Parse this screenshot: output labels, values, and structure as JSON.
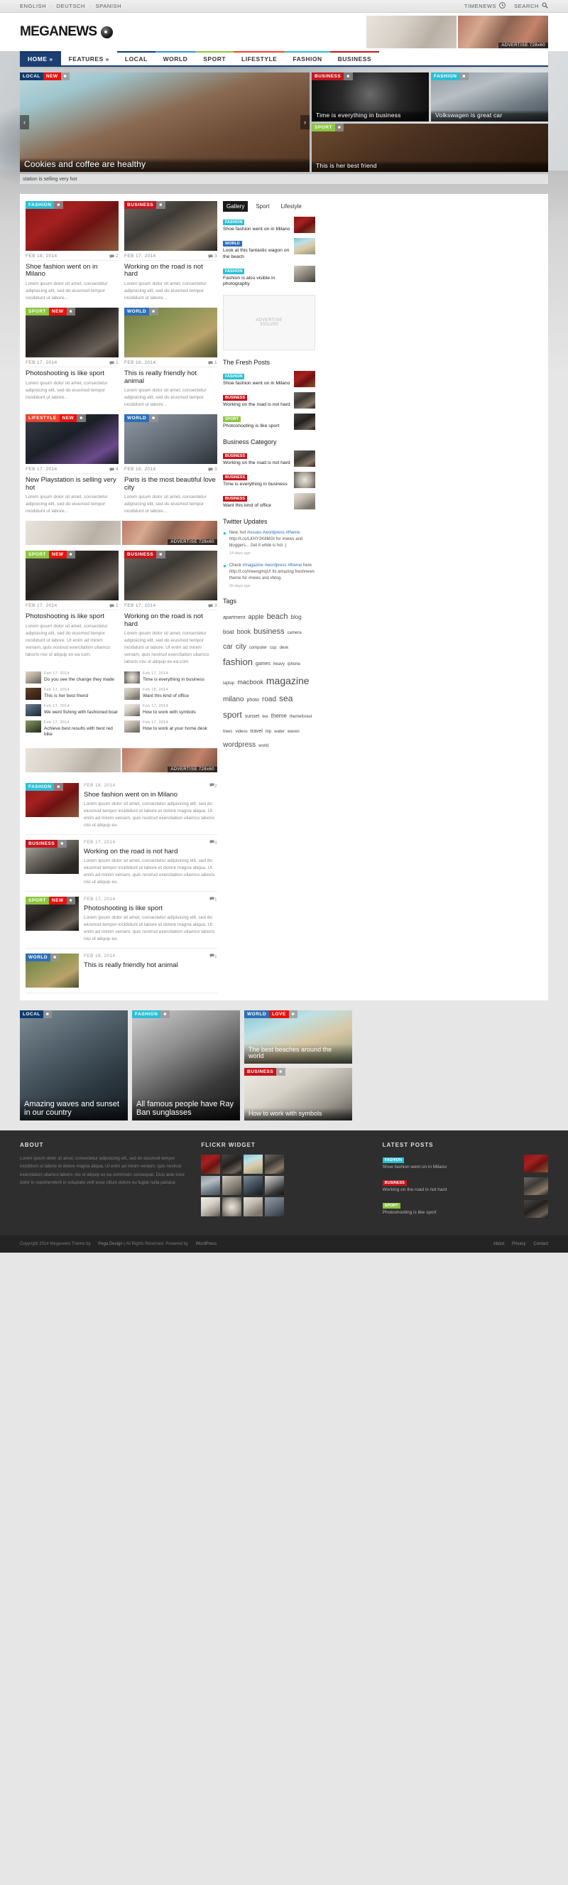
{
  "topbar": {
    "languages": [
      "ENGLISH",
      "DEUTSCH",
      "SPANISH"
    ],
    "separator": "·",
    "timenews_label": "TIMENEWS",
    "search_label": "SEARCH",
    "clock_icon": "clock-icon",
    "search_icon": "search-icon"
  },
  "header": {
    "logo_mega": "MEGA",
    "logo_news": "NEWS",
    "ad_label": "ADVERTISE  728x60"
  },
  "nav": {
    "items": [
      {
        "label": "HOME »",
        "active": true,
        "cls": ""
      },
      {
        "label": "FEATURES »",
        "active": false,
        "cls": ""
      },
      {
        "label": "LOCAL",
        "active": false,
        "cls": "c-local"
      },
      {
        "label": "WORLD",
        "active": false,
        "cls": "c-world"
      },
      {
        "label": "SPORT",
        "active": false,
        "cls": "c-sport"
      },
      {
        "label": "LIFESTYLE",
        "active": false,
        "cls": "c-life"
      },
      {
        "label": "FASHION",
        "active": false,
        "cls": "c-fash"
      },
      {
        "label": "BUSINESS",
        "active": false,
        "cls": "c-bus"
      }
    ]
  },
  "slider": {
    "prev_icon": "chevron-left-icon",
    "next_icon": "chevron-right-icon",
    "main": {
      "badges": [
        {
          "text": "LOCAL",
          "cls": "b-local"
        },
        {
          "text": "NEW",
          "cls": "b-new"
        }
      ],
      "icon": "camera-icon",
      "caption": "Cookies and coffee are healthy"
    },
    "cells": [
      {
        "badges": [
          {
            "text": "BUSINESS",
            "cls": "b-bus"
          }
        ],
        "icon": "camera-icon",
        "caption": "Time is everything in business",
        "photo": "ph-clock"
      },
      {
        "badges": [
          {
            "text": "FASHION",
            "cls": "b-fash"
          }
        ],
        "icon": "camera-icon",
        "caption": "Volkswagen is great car",
        "photo": "ph-van"
      },
      {
        "badges": [
          {
            "text": "SPORT",
            "cls": "b-sport"
          }
        ],
        "icon": "camera-icon",
        "caption": "This is her best friend",
        "photo": "ph-dog"
      }
    ]
  },
  "ticker": {
    "text": "station is selling very hot"
  },
  "posts_grid": [
    [
      {
        "badges": [
          {
            "text": "FASHION",
            "cls": "b-fash"
          }
        ],
        "icon": "camera-icon",
        "photo": "ph-shoe",
        "date": "FEB 18, 2014",
        "comments": "2",
        "title": "Shoe fashion went on in Milano",
        "excerpt": "Lorem ipsum dolor sit amet, consectetur adipisicing elit, sed do eiusmod tempor incididunt ut labore..."
      },
      {
        "badges": [
          {
            "text": "BUSINESS",
            "cls": "b-bus"
          }
        ],
        "icon": "camera-icon",
        "photo": "ph-laptop",
        "date": "FEB 17, 2014",
        "comments": "3",
        "title": "Working on the road is not hard",
        "excerpt": "Lorem ipsum dolor sit amet, consectetur adipisicing elit, sed do eiusmod tempor incididunt ut labore..."
      }
    ],
    [
      {
        "badges": [
          {
            "text": "SPORT",
            "cls": "b-sport"
          },
          {
            "text": "NEW",
            "cls": "b-new"
          }
        ],
        "icon": "camera-icon",
        "photo": "ph-camera",
        "date": "FEB 17, 2014",
        "comments": "1",
        "title": "Photoshooting is like sport",
        "excerpt": "Lorem ipsum dolor sit amet, consectetur adipisicing elit, sed do eiusmod tempor incididunt ut labore..."
      },
      {
        "badges": [
          {
            "text": "WORLD",
            "cls": "b-world"
          }
        ],
        "icon": "camera-icon",
        "photo": "ph-leopard",
        "date": "FEB 16, 2014",
        "comments": "1",
        "title": "This is really friendly hot animal",
        "excerpt": "Lorem ipsum dolor sit amet, consectetur adipisicing elit, sed do eiusmod tempor incididunt ut labore..."
      }
    ],
    [
      {
        "badges": [
          {
            "text": "LIFESTYLE",
            "cls": "b-life"
          },
          {
            "text": "NEW",
            "cls": "b-new"
          }
        ],
        "icon": "camera-icon",
        "photo": "ph-play",
        "date": "FEB 17, 2014",
        "comments": "4",
        "title": "New Playstation is selling very hot",
        "excerpt": "Lorem ipsum dolor sit amet, consectetur adipisicing elit, sed do eiusmod tempor incididunt ut labore..."
      },
      {
        "badges": [
          {
            "text": "WORLD",
            "cls": "b-world"
          }
        ],
        "icon": "camera-icon",
        "photo": "ph-paris",
        "date": "FEB 16, 2014",
        "comments": "3",
        "title": "Paris is the most beautiful love city",
        "excerpt": "Lorem ipsum dolor sit amet, consectetur adipisicing elit, sed do eiusmod tempor incididunt ut labore..."
      }
    ]
  ],
  "inline_ad_label": "ADVERTISE  728x60",
  "posts_grid2": [
    {
      "badges": [
        {
          "text": "SPORT",
          "cls": "b-sport"
        },
        {
          "text": "NEW",
          "cls": "b-new"
        }
      ],
      "icon": "camera-icon",
      "photo": "ph-camera",
      "date": "FEB 17, 2014",
      "comments": "1",
      "title": "Photoshooting is like sport",
      "excerpt": "Lorem ipsum dolor sit amet, consectetur adipisicing elit, sed do eiusmod tempor incididunt ut labore. Ut enim ad minim veniam, quis nostrud exercitation ullamco laboris nisi ut aliquip ex ea com."
    },
    {
      "badges": [
        {
          "text": "BUSINESS",
          "cls": "b-bus"
        }
      ],
      "icon": "camera-icon",
      "photo": "ph-laptop",
      "date": "FEB 17, 2014",
      "comments": "3",
      "title": "Working on the road is not hard",
      "excerpt": "Lorem ipsum dolor sit amet, consectetur adipisicing elit, sed do eiusmod tempor incididunt ut labore. Ut enim ad minim veniam, quis nostrud exercitation ullamco laboris nisi ut aliquip ex ea com."
    }
  ],
  "small_list": [
    [
      {
        "date": "Feb 17, 2014",
        "title": "Do you see the change they made",
        "photo": "ph-desk"
      },
      {
        "date": "Feb 17, 2014",
        "title": "This is her best friend",
        "photo": "ph-dog"
      },
      {
        "date": "Feb 17, 2014",
        "title": "We went fishing with fashioned boat",
        "photo": "ph-fish"
      },
      {
        "date": "Feb 17, 2014",
        "title": "Achieve best results with best red bike",
        "photo": "ph-bike"
      }
    ],
    [
      {
        "date": "Feb 17, 2014",
        "title": "Time is everything in business",
        "photo": "ph-clock2"
      },
      {
        "date": "Feb 18, 2014",
        "title": "Want this kind of office",
        "photo": "ph-office"
      },
      {
        "date": "Feb 17, 2014",
        "title": "How to work with symbols",
        "photo": "ph-symbol"
      },
      {
        "date": "Feb 17, 2014",
        "title": "How to work at your home desk",
        "photo": "ph-home"
      }
    ]
  ],
  "wide_posts": [
    {
      "badges": [
        {
          "text": "FASHION",
          "cls": "b-fash"
        }
      ],
      "icon": "camera-icon",
      "photo": "ph-shoe",
      "date": "FEB 18, 2014",
      "comments": "2",
      "title": "Shoe fashion went on in Milano",
      "excerpt": "Lorem ipsum dolor sit amet, consectetur adipisicing elit, sed do eiusmod tempor incididunt ut labore et dolore magna aliqua. Ut enim ad minim veniam, quis nostrud exercitation ullamco laboris nisi ut aliquip ex."
    },
    {
      "badges": [
        {
          "text": "BUSINESS",
          "cls": "b-bus"
        }
      ],
      "icon": "camera-icon",
      "photo": "ph-phone",
      "date": "FEB 17, 2014",
      "comments": "3",
      "title": "Working on the road is not hard",
      "excerpt": "Lorem ipsum dolor sit amet, consectetur adipisicing elit, sed do eiusmod tempor incididunt ut labore et dolore magna aliqua. Ut enim ad minim veniam, quis nostrud exercitation ullamco laboris nisi ut aliquip ex."
    },
    {
      "badges": [
        {
          "text": "SPORT",
          "cls": "b-sport"
        },
        {
          "text": "NEW",
          "cls": "b-new"
        }
      ],
      "icon": "camera-icon",
      "photo": "ph-camera",
      "date": "FEB 17, 2014",
      "comments": "1",
      "title": "Photoshooting is like sport",
      "excerpt": "Lorem ipsum dolor sit amet, consectetur adipisicing elit, sed do eiusmod tempor incididunt ut labore et dolore magna aliqua. Ut enim ad minim veniam, quis nostrud exercitation ullamco laboris nisi ut aliquip ex."
    },
    {
      "badges": [
        {
          "text": "WORLD",
          "cls": "b-world"
        }
      ],
      "icon": "camera-icon",
      "photo": "ph-leopard",
      "date": "FEB 16, 2014",
      "comments": "1",
      "title": "This is really friendly hot animal",
      "excerpt": ""
    }
  ],
  "sidebar": {
    "tabs": [
      {
        "label": "Gallery",
        "on": true
      },
      {
        "label": "Sport",
        "on": false
      },
      {
        "label": "Lifestyle",
        "on": false
      }
    ],
    "tab_items": [
      {
        "badge": "FASHION",
        "cls": "b-fash",
        "title": "Shoe fashion went on in Milano",
        "photo": "ph-shoe"
      },
      {
        "badge": "WORLD",
        "cls": "b-world",
        "title": "Look at this fantastic wagon on the beach",
        "photo": "ph-beach"
      },
      {
        "badge": "FASHION",
        "cls": "b-fash",
        "title": "Fashion is also visible in photography",
        "photo": "ph-city"
      }
    ],
    "ad": {
      "line1": "ADVERTISE",
      "line2": "300x250"
    },
    "fresh": {
      "title": "The Fresh Posts",
      "items": [
        {
          "badge": "FASHION",
          "cls": "b-fash",
          "title": "Shoe fashion went on in Milano",
          "photo": "ph-shoe"
        },
        {
          "badge": "BUSINESS",
          "cls": "b-bus",
          "title": "Working on the road is not hard",
          "photo": "ph-laptop"
        },
        {
          "badge": "SPORT",
          "cls": "b-sport",
          "title": "Photoshooting is like sport",
          "photo": "ph-camera"
        }
      ]
    },
    "business": {
      "title": "Business Category",
      "items": [
        {
          "badge": "BUSINESS",
          "cls": "b-bus",
          "title": "Working on the road is not hard",
          "photo": "ph-laptop"
        },
        {
          "badge": "BUSINESS",
          "cls": "b-bus",
          "title": "Time is everything in business",
          "photo": "ph-clock2"
        },
        {
          "badge": "BUSINESS",
          "cls": "b-bus",
          "title": "Want this kind of office",
          "photo": "ph-office"
        }
      ]
    },
    "twitter": {
      "title": "Twitter Updates",
      "bird_icon": "twitter-bird-icon",
      "items": [
        {
          "pre": "New, hot ",
          "links": [
            "#issues",
            "#wordpress",
            "#theme"
          ],
          "body": "http://t.co/LKHY2K8MGt for #news and bloggers... Get it while is hot :)",
          "ago": "14 days ago"
        },
        {
          "pre": "Check ",
          "links": [
            "#magazine",
            "#wordpress",
            "#theme"
          ],
          "body": "here http://t.co/meexgmqU! Its amazing freshnews theme for #news and #blog.",
          "ago": "20 days ago"
        }
      ]
    },
    "tags": {
      "title": "Tags",
      "items": [
        {
          "t": "apartment",
          "s": 7
        },
        {
          "t": "apple",
          "s": 9
        },
        {
          "t": "beach",
          "s": 11
        },
        {
          "t": "blog",
          "s": 8
        },
        {
          "t": "boat",
          "s": 8
        },
        {
          "t": "book",
          "s": 9
        },
        {
          "t": "business",
          "s": 11
        },
        {
          "t": "camera",
          "s": 6
        },
        {
          "t": "car",
          "s": 10
        },
        {
          "t": "city",
          "s": 10
        },
        {
          "t": "computer",
          "s": 6
        },
        {
          "t": "cup",
          "s": 6
        },
        {
          "t": "desk",
          "s": 6
        },
        {
          "t": "fashion",
          "s": 13
        },
        {
          "t": "games",
          "s": 7
        },
        {
          "t": "heavy",
          "s": 6
        },
        {
          "t": "iphone",
          "s": 6
        },
        {
          "t": "laptop",
          "s": 6
        },
        {
          "t": "macbook",
          "s": 9
        },
        {
          "t": "magazine",
          "s": 14
        },
        {
          "t": "milano",
          "s": 10
        },
        {
          "t": "photo",
          "s": 7
        },
        {
          "t": "road",
          "s": 10
        },
        {
          "t": "sea",
          "s": 12
        },
        {
          "t": "sport",
          "s": 12
        },
        {
          "t": "sunset",
          "s": 7
        },
        {
          "t": "tee",
          "s": 6
        },
        {
          "t": "theme",
          "s": 8
        },
        {
          "t": "themeforest",
          "s": 6
        },
        {
          "t": "trees",
          "s": 6
        },
        {
          "t": "videos",
          "s": 6
        },
        {
          "t": "travel",
          "s": 7
        },
        {
          "t": "trip",
          "s": 6
        },
        {
          "t": "water",
          "s": 6
        },
        {
          "t": "waves",
          "s": 6
        },
        {
          "t": "wordpress",
          "s": 10
        },
        {
          "t": "world",
          "s": 6
        }
      ]
    }
  },
  "bottom_features": [
    {
      "badges": [
        {
          "text": "LOCAL",
          "cls": "b-local"
        }
      ],
      "icon": "camera-icon",
      "photo": "ph-waves",
      "caption": "Amazing waves and sunset in our country"
    },
    {
      "badges": [
        {
          "text": "FASHION",
          "cls": "b-fash"
        }
      ],
      "icon": "camera-icon",
      "photo": "ph-bag",
      "caption": "All famous people have Ray Ban sunglasses"
    },
    {
      "badges": [
        {
          "text": "WORLD",
          "cls": "b-world"
        },
        {
          "text": "LOVE",
          "cls": "b-new"
        }
      ],
      "icon": "camera-icon",
      "photo": "ph-beach",
      "caption": "The best beaches around the world"
    },
    {
      "badges": [
        {
          "text": "BUSINESS",
          "cls": "b-bus"
        }
      ],
      "icon": "camera-icon",
      "photo": "ph-symbol",
      "caption": "How to work with symbols"
    }
  ],
  "footer": {
    "about": {
      "title": "ABOUT",
      "text": "Lorem ipsum dolor sit amet, consectetur adipisicing elit, sed do eiusmod tempor incididunt ut labore et dolore magna aliqua. Ut enim ad minim veniam, quis nostrud exercitation ullamco laboris nisi ut aliquip ex ea commodo consequat. Duis aute irure dolor in reprehenderit in voluptate velit esse cillum dolore eu fugiat nulla pariatur."
    },
    "flickr": {
      "title": "FLICKR WIDGET",
      "cells": [
        "ph-shoe",
        "ph-camera",
        "ph-beach",
        "ph-laptop",
        "ph-van",
        "ph-city",
        "ph-waves",
        "ph-bag",
        "ph-symbol",
        "ph-clock2",
        "ph-office",
        "ph-paris"
      ]
    },
    "latest": {
      "title": "LATEST POSTS",
      "items": [
        {
          "badge": "FASHION",
          "cls": "b-fash",
          "title": "Shoe fashion went on in Milano",
          "photo": "ph-shoe"
        },
        {
          "badge": "BUSINESS",
          "cls": "b-bus",
          "title": "Working on the road is not hard",
          "photo": "ph-laptop"
        },
        {
          "badge": "SPORT",
          "cls": "b-sport",
          "title": "Photoshooting is like sport",
          "photo": "ph-camera"
        }
      ]
    }
  },
  "copyright": {
    "text_pre": "Copyright 2014 Meganews Theme by ",
    "link1": "Pega Design",
    "text_mid": " | All Rights Reserved. Powered by ",
    "link2": "WordPress",
    "links": [
      "About",
      "Privacy",
      "Contact"
    ]
  }
}
